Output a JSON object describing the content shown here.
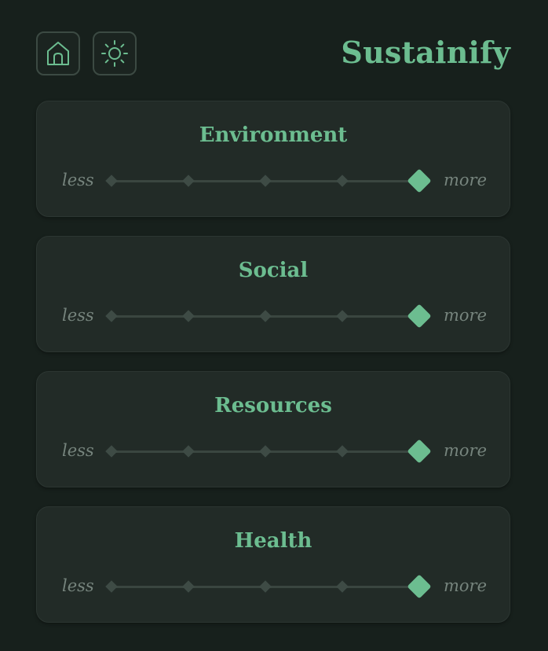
{
  "header": {
    "app_title": "Sustainify",
    "home_icon": "home-icon",
    "theme_icon": "sun-icon"
  },
  "colors": {
    "background": "#17201c",
    "card": "#222b27",
    "accent": "#6cbd90",
    "muted": "#76847d"
  },
  "sliders": [
    {
      "label": "Environment",
      "min_label": "less",
      "max_label": "more",
      "steps": 5,
      "value_index": 4
    },
    {
      "label": "Social",
      "min_label": "less",
      "max_label": "more",
      "steps": 5,
      "value_index": 4
    },
    {
      "label": "Resources",
      "min_label": "less",
      "max_label": "more",
      "steps": 5,
      "value_index": 4
    },
    {
      "label": "Health",
      "min_label": "less",
      "max_label": "more",
      "steps": 5,
      "value_index": 4
    }
  ]
}
